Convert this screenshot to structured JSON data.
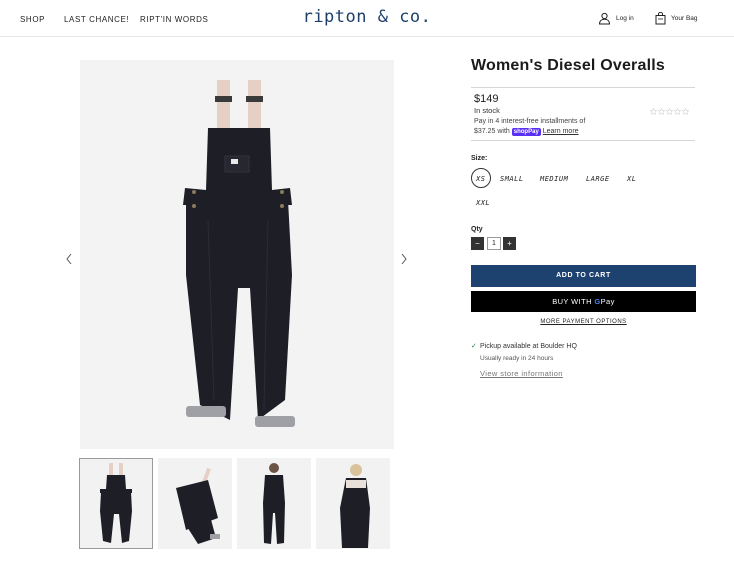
{
  "nav": {
    "links": [
      "SHOP",
      "LAST CHANCE!",
      "RIPT'IN WORDS"
    ],
    "logo": "ripton & co.",
    "login": "Log in",
    "bag": "Your Bag"
  },
  "product": {
    "title": "Women's Diesel Overalls",
    "price": "$149",
    "stock": "In stock",
    "installments_line1": "Pay in 4 interest-free installments of",
    "installments_amount": "$37.25 with",
    "shop_pay": "shop",
    "shop_pay_suffix": "Pay",
    "learn_more": "Learn more",
    "rating_stars": 0,
    "size_label": "Size:",
    "sizes": [
      "XS",
      "SMALL",
      "MEDIUM",
      "LARGE",
      "XL",
      "XXL"
    ],
    "selected_size": "XS",
    "qty_label": "Qty",
    "qty_minus": "−",
    "qty_value": "1",
    "qty_plus": "+",
    "add_to_cart": "ADD TO CART",
    "buy_with": "BUY WITH",
    "gpay_g": "G",
    "gpay_pay": "Pay",
    "more_payment": "MORE PAYMENT OPTIONS",
    "pickup_check": "✓",
    "pickup": "Pickup available at Boulder HQ",
    "ready": "Usually ready in 24 hours",
    "store_info": "View store information"
  },
  "icons": {
    "prev": "chevron-left-icon",
    "next": "chevron-right-icon",
    "login": "user-icon",
    "bag": "bag-icon"
  },
  "colors": {
    "brand": "#1d3f6a",
    "cart_button": "#1d4270",
    "gpay_button": "#000000",
    "shop_pay": "#5a31f4",
    "denim": "#1e1f26",
    "straps": "#e6cfc4"
  }
}
